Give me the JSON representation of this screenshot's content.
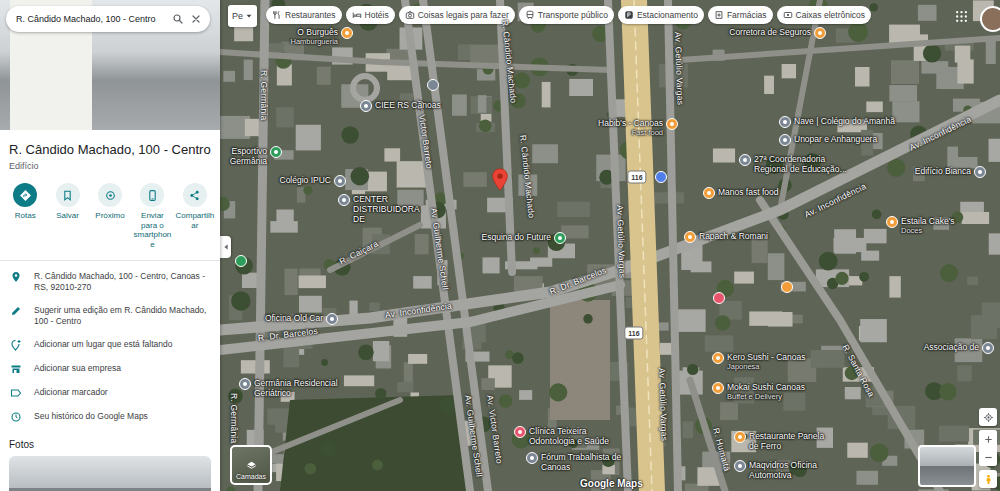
{
  "search": {
    "query": "R. Cândido Machado, 100 - Centro"
  },
  "place": {
    "title": "R. Cândido Machado, 100 - Centro",
    "category": "Edifício"
  },
  "actions": [
    {
      "label": "Rotas",
      "primary": true
    },
    {
      "label": "Salvar",
      "primary": false
    },
    {
      "label": "Próximo",
      "primary": false
    },
    {
      "label": "Enviar para o smartphone",
      "primary": false
    },
    {
      "label": "Compartilhar",
      "primary": false
    }
  ],
  "info_rows": [
    "R. Cândido Machado, 100 - Centro, Canoas - RS, 92010-270",
    "Sugerir uma edição em R. Cândido Machado, 100 - Centro",
    "Adicionar um lugar que está faltando",
    "Adicionar sua empresa",
    "Adicionar marcador",
    "Seu histórico do Google Maps"
  ],
  "photos": {
    "title": "Fotos"
  },
  "map": {
    "type_button": "Pe",
    "chips": [
      "Restaurantes",
      "Hotéis",
      "Coisas legais para fazer",
      "Transporte público",
      "Estacionamento",
      "Farmácias",
      "Caixas eletrônicos"
    ],
    "places": [
      {
        "name": "O Burguês",
        "sub": "Hamburgueria",
        "color": "#f29d38"
      },
      {
        "name": "Corretora de Seguros",
        "color": "#f29d38"
      },
      {
        "name": "CIEE RS Canoas",
        "color": "#7b8794"
      },
      {
        "name": "Colégio IPUC",
        "color": "#7b8794"
      },
      {
        "name": "Esportivo Germânia",
        "color": "#2e9d5b"
      },
      {
        "name": "CENTER DISTRIBUIDORA DE",
        "color": "#7b8794"
      },
      {
        "name": "Esquina do Future",
        "color": "#2e9d5b"
      },
      {
        "name": "Habib's - Canoas",
        "sub": "Fast food",
        "color": "#f29d38"
      },
      {
        "name": "Manos fast food",
        "color": "#f29d38"
      },
      {
        "name": "Rapach & Romani",
        "color": "#f29d38"
      },
      {
        "name": "Nave | Colégio do Amanhã",
        "color": "#7b8794"
      },
      {
        "name": "Unopar e Anhanguera",
        "color": "#7b8794"
      },
      {
        "name": "27ª Coordenadoria Regional de Educação...",
        "color": "#7b8794"
      },
      {
        "name": "Edifício Bianca",
        "color": "#7b8794"
      },
      {
        "name": "Estaila Cake's",
        "sub": "Doces",
        "color": "#f29d38"
      },
      {
        "name": "Kero Sushi - Canoas",
        "sub": "Japonesa",
        "color": "#f29d38"
      },
      {
        "name": "Mokai Sushi Canoas",
        "sub": "Buffet e Delivery",
        "color": "#f29d38"
      },
      {
        "name": "Restaurante Panela de Ferro",
        "color": "#f29d38"
      },
      {
        "name": "Maqvidros Oficina Automotiva",
        "color": "#7b8794"
      },
      {
        "name": "Germânia Residencial Geriátrico",
        "color": "#7b8794"
      },
      {
        "name": "Clínica Teixeira Odontologia e Saúde",
        "color": "#e8546b"
      },
      {
        "name": "Fórum Trabalhista de Canoas",
        "color": "#7b8794"
      },
      {
        "name": "Oficina Old Car",
        "color": "#7b8794"
      },
      {
        "name": "Associação de",
        "color": "#7b8794"
      }
    ],
    "streets": [
      "R. Germânia",
      "R. Germânia",
      "R. Cândido Machado",
      "R. Cândido Machado",
      "Av. Victor Barreto",
      "Av. Victor Barreto",
      "Av. Guilherme Schell",
      "Av. Guilherme Schell",
      "Av. Getúlio Vargas",
      "Av. Getúlio Vargas",
      "Av. Getúlio Vargas",
      "R. Dr. Barcelos",
      "R. Dr. Barcelos",
      "Av. Inconfidência",
      "Av. Inconfidência",
      "Av. Inconfidência",
      "R. Santa Rosa",
      "R. Humaitá",
      "R. Caiçara"
    ],
    "shields": [
      "116",
      "116"
    ],
    "layers_label": "Camadas",
    "logo": "Google Maps"
  }
}
